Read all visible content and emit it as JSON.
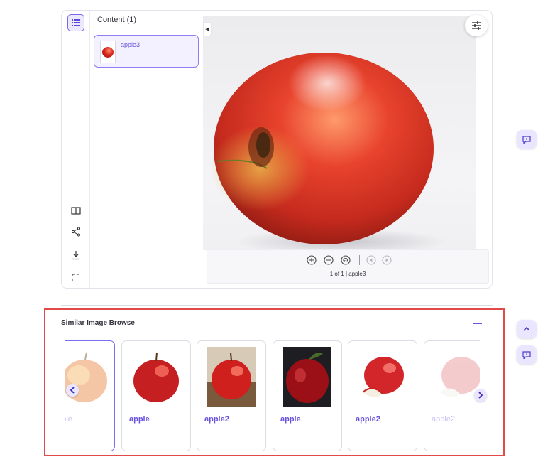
{
  "content_panel": {
    "title": "Content (1)",
    "items": [
      {
        "label": "apple3"
      }
    ]
  },
  "viewer": {
    "page_info": "1 of 1 | apple3",
    "tools": [
      "zoom-in-icon",
      "zoom-out-icon",
      "rotate-icon",
      "previous-icon",
      "next-icon"
    ]
  },
  "rail": {
    "icons": [
      "list-icon",
      "book-icon",
      "share-icon",
      "download-icon",
      "fullscreen-icon"
    ]
  },
  "similar": {
    "title": "Similar Image Browse",
    "cards": [
      {
        "label": "apple"
      },
      {
        "label": "apple"
      },
      {
        "label": "apple2"
      },
      {
        "label": "apple"
      },
      {
        "label": "apple2"
      },
      {
        "label": "apple2"
      }
    ]
  },
  "colors": {
    "accent": "#6a56e6",
    "highlight_border": "#e24a4a",
    "selected_bg": "#f3f1ff"
  }
}
